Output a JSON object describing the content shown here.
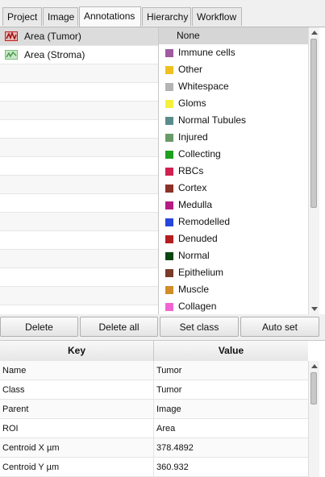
{
  "tabs": [
    {
      "label": "Project",
      "active": false
    },
    {
      "label": "Image",
      "active": false
    },
    {
      "label": "Annotations",
      "active": true
    },
    {
      "label": "Hierarchy",
      "active": false
    },
    {
      "label": "Workflow",
      "active": false
    }
  ],
  "annotations": [
    {
      "label": "Area (Tumor)",
      "color": "#c81e1e",
      "selected": true
    },
    {
      "label": "Area (Stroma)",
      "color": "#7cc07c",
      "selected": false
    }
  ],
  "classes": [
    {
      "label": "None",
      "color": ""
    },
    {
      "label": "Immune cells",
      "color": "#a05aa0"
    },
    {
      "label": "Other",
      "color": "#f0c020"
    },
    {
      "label": "Whitespace",
      "color": "#b4b4b4"
    },
    {
      "label": "Gloms",
      "color": "#f5f03c"
    },
    {
      "label": "Normal Tubules",
      "color": "#5a8c8c"
    },
    {
      "label": "Injured",
      "color": "#6a9a6a"
    },
    {
      "label": "Collecting",
      "color": "#1ea01e"
    },
    {
      "label": "RBCs",
      "color": "#d22050"
    },
    {
      "label": "Cortex",
      "color": "#8c3228"
    },
    {
      "label": "Medulla",
      "color": "#b41e82"
    },
    {
      "label": "Remodelled",
      "color": "#2846dc"
    },
    {
      "label": "Denuded",
      "color": "#b41e1e"
    },
    {
      "label": "Normal",
      "color": "#0a4614"
    },
    {
      "label": "Epithelium",
      "color": "#783c28"
    },
    {
      "label": "Muscle",
      "color": "#d28c28"
    },
    {
      "label": "Collagen",
      "color": "#f064d2"
    }
  ],
  "buttons": {
    "delete": "Delete",
    "delete_all": "Delete all",
    "set_class": "Set class",
    "auto_set": "Auto set"
  },
  "table": {
    "key_header": "Key",
    "value_header": "Value",
    "rows": [
      {
        "key": "Name",
        "value": "Tumor"
      },
      {
        "key": "Class",
        "value": "Tumor"
      },
      {
        "key": "Parent",
        "value": "Image"
      },
      {
        "key": "ROI",
        "value": "Area"
      },
      {
        "key": "Centroid X µm",
        "value": "378.4892"
      },
      {
        "key": "Centroid Y µm",
        "value": "360.932"
      }
    ]
  }
}
